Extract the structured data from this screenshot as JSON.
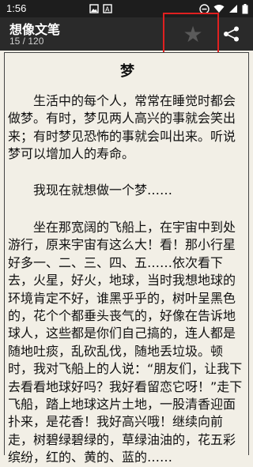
{
  "status_bar": {
    "time": "1:56",
    "icons": [
      "image-notification-icon",
      "text-notification-icon",
      "do-not-disturb-icon",
      "wifi-icon",
      "signal-icon",
      "battery-icon"
    ]
  },
  "header": {
    "book_title": "想像文笔",
    "page_counter": "15 / 120",
    "bookmark_icon": "star-icon",
    "share_icon": "share-icon"
  },
  "content": {
    "chapter_title": "梦",
    "paragraphs": [
      "生活中的每个人，常常在睡觉时都会做梦。有时，梦见两人高兴的事就会笑出来；有时梦见恐怖的事就会叫出来。听说梦可以增加人的寿命。",
      "我现在就想做一个梦……",
      "坐在那宽阔的飞船上，在宇宙中到处游行，原来宇宙有这么大！看！那小行星好多一、二、三、四、五……依次看下去，火星，好火，地球，当时我想地球的环境肯定不好，谁黑乎乎的，树叶呈黑色的，花个个都垂头丧气的，好像在告诉地球人，这些都是你们自己搞的，连人都是随地吐痰，乱砍乱伐，随地丢垃圾。顿时，我对飞船上的人说：“朋友们，让我下去看看地球好吗？我好看留恋它呀！”走下飞船，踏上地球这片土地，一股清香迎面扑来，是花香！我好高兴哦！继续向前走，树碧绿碧绿的，草绿油油的，花五彩缤纷，红的、黄的、蓝的……"
    ]
  }
}
